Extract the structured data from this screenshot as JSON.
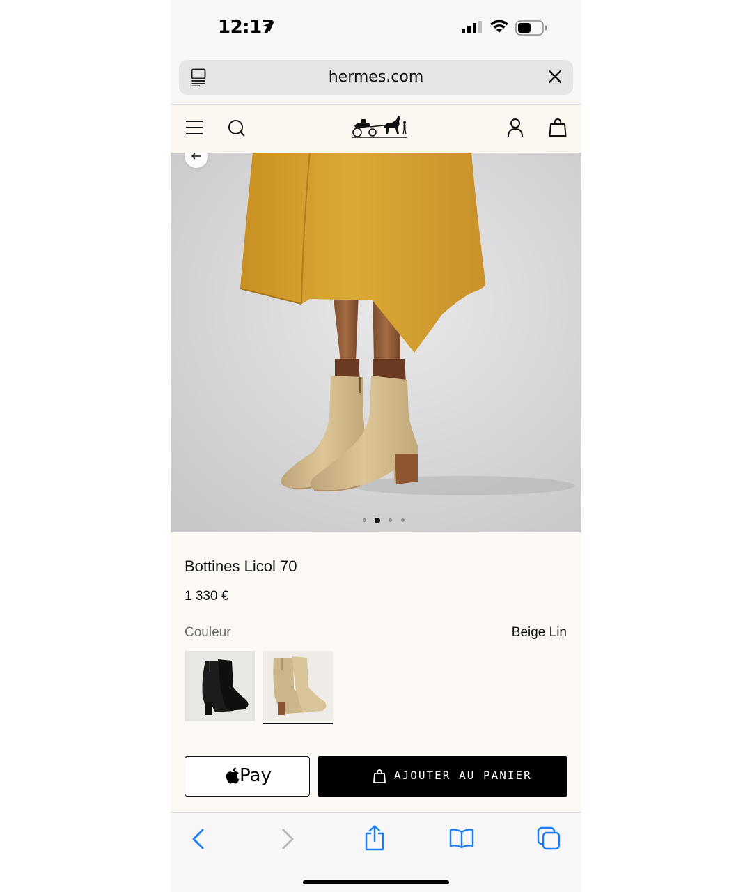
{
  "status_bar": {
    "time": "12:17",
    "icons": [
      "location-arrow-icon",
      "cellular-signal-icon",
      "wifi-icon",
      "battery-icon"
    ]
  },
  "browser": {
    "url": "hermes.com",
    "left_icon": "reader-view-icon",
    "right_icon": "close-icon"
  },
  "site_header": {
    "icons": [
      "menu-icon",
      "search-icon",
      "hermes-logo",
      "account-icon",
      "bag-icon"
    ]
  },
  "gallery": {
    "image_count": 4,
    "active_index": 1
  },
  "product": {
    "name": "Bottines Licol 70",
    "price": "1 330 €",
    "color_label": "Couleur",
    "color_value": "Beige Lin",
    "swatches": [
      "black",
      "beige"
    ],
    "selected_swatch": "beige"
  },
  "actions": {
    "apple_pay_label": "Pay",
    "add_to_cart_label": "AJOUTER AU PANIER"
  },
  "toolbar": {
    "icons": [
      "back-icon",
      "forward-icon",
      "share-icon",
      "bookmarks-icon",
      "tabs-icon"
    ]
  },
  "colors": {
    "accent_blue": "#1a7cf5",
    "page_bg": "#fcf8f4",
    "coat": "#d9a32f",
    "boot": "#d6bf92",
    "button_black": "#000000"
  }
}
